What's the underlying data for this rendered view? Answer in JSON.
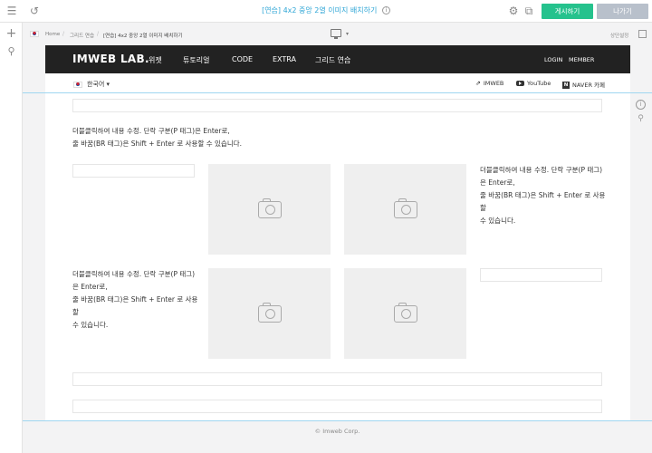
{
  "topbar": {
    "title": "[연습] 4x2 중앙 2열 이미지 배치하기",
    "publish_label": "게시하기",
    "exit_label": "나가기",
    "icons": [
      "menu-icon",
      "undo-icon",
      "info-icon",
      "gear-icon",
      "external-link-icon"
    ]
  },
  "leftbar": {
    "icons": [
      "plus-icon",
      "pin-icon"
    ]
  },
  "breadcrumb": {
    "home": "Home",
    "section": "그리드 연습",
    "current": "[연습] 4x2 중앙 2열 이미지 배치하기",
    "settings": "상단설정"
  },
  "site": {
    "logo": "IMWEB LAB.",
    "nav": [
      "위젯",
      "튜토리얼",
      "CODE",
      "EXTRA",
      "그리드 연습"
    ],
    "login": "LOGIN",
    "member": "MEMBER",
    "language": "한국어 ▾",
    "links": {
      "imweb": "IMWEB",
      "youtube": "YouTube",
      "naver": "NAVER 카페"
    }
  },
  "content": {
    "intro_line1": "더블클릭하여 내용 수정. 단락 구분(P 태그)은 Enter로,",
    "intro_line2": "줄 바꿈(BR 태그)은 Shift + Enter 로 사용할 수 있습니다.",
    "right_text": [
      "더블클릭하여 내용 수정. 단락 구분(P 태그)",
      "은 Enter로,",
      "줄 바꿈(BR 태그)은 Shift + Enter 로 사용할",
      "수 있습니다."
    ],
    "left_text": [
      "더블클릭하여 내용 수정. 단락 구분(P 태그)",
      "은 Enter로,",
      "줄 바꿈(BR 태그)은 Shift + Enter 로 사용할",
      "수 있습니다."
    ]
  },
  "footer": {
    "copyright": "© Imweb Corp."
  },
  "colors": {
    "accent": "#2fa6d6",
    "publish": "#25c28d",
    "exit": "#b8c0cb",
    "header_bg": "#222222"
  }
}
